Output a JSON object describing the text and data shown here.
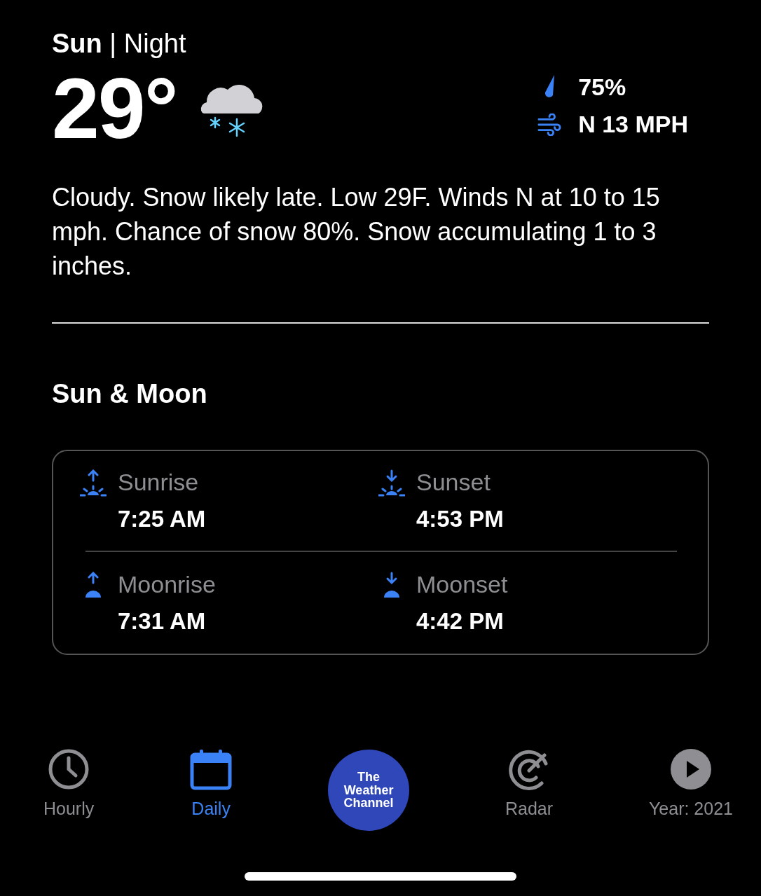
{
  "header": {
    "title": "**Sun** | Night"
  },
  "current": {
    "temperature": "29°",
    "humidity": "75%",
    "wind": "N 13 MPH"
  },
  "description": "Cloudy. Snow likely late. Low 29F. Winds N at 10 to 15 mph. Chance of snow 80%. Snow accumulating 1 to 3 inches.",
  "sun_moon": {
    "title": "Sun & Moon",
    "items": [
      {
        "label": "Sunrise",
        "time": "7:25 AM"
      },
      {
        "label": "Sunset",
        "time": "4:53 PM"
      },
      {
        "label": "Moonrise",
        "time": "7:31 AM"
      },
      {
        "label": "Moonset",
        "time": "4:42 PM"
      }
    ]
  },
  "tab_bar": [
    {
      "kind": "tab",
      "label": "Hourly",
      "selected": false
    },
    {
      "kind": "tab",
      "label": "Daily",
      "selected": true
    },
    {
      "kind": "logo",
      "lines": [
        "The",
        "Weather",
        "Channel"
      ]
    },
    {
      "kind": "tab",
      "label": "Radar",
      "selected": false
    },
    {
      "kind": "tab",
      "label": "Year: 2021",
      "selected": false
    }
  ]
}
